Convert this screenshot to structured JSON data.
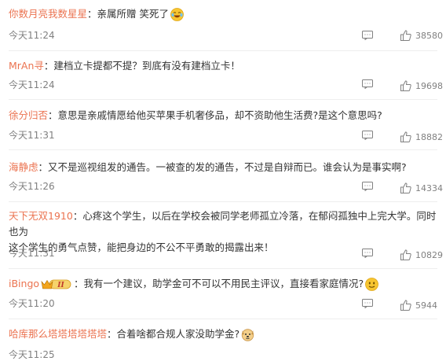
{
  "comments": [
    {
      "user": "你数月亮我数星星",
      "text": "亲属所赠 笑死了",
      "emoji": "laughing-tears-emoji",
      "time": "今天11:24",
      "likes": "38580"
    },
    {
      "user": "MrAn寻",
      "text": "建档立卡提都不提？到底有没有建档立卡！",
      "time": "今天11:24",
      "likes": "19698"
    },
    {
      "user": "徐分归否",
      "text": "意思是亲戚情愿给他买苹果手机奢侈品，却不资助他生活费?是这个意思吗?",
      "time": "今天11:31",
      "likes": "18882"
    },
    {
      "user": "海静虑",
      "text": "又不是巡视组发的通告。一被查的发的通告，不过是自辩而已。谁会认为是事实啊?",
      "time": "今天11:26",
      "likes": "14334"
    },
    {
      "user": "天下无双1910",
      "text_line1": "心疼这个学生，以后在学校会被同学老师孤立冷落，在郁闷孤独中上完大学。同时也为",
      "text_line2": "这个学生的勇气点赞，能把身边的不公不平勇敢的揭露出来！",
      "time": "今天11:31",
      "likes": "10829"
    },
    {
      "user": "iBingo",
      "badge_level": "II",
      "text": "我有一个建议，助学金可不可以不用民主评议，直接看家庭情况?",
      "emoji": "slightly-smiling-emoji",
      "time": "今天11:20",
      "likes": "5944"
    },
    {
      "user": "哈库那么塔塔塔塔塔塔",
      "text": "合着啥都合规人家没助学金?",
      "emoji": "dog-face-emoji",
      "time": "今天11:25"
    }
  ],
  "colors": {
    "username": "#eb7350",
    "meta": "#808080",
    "text": "#333333",
    "separator": "#eeeeee"
  },
  "icons": {
    "reply": "comment-icon",
    "like": "thumbs-up-icon"
  }
}
